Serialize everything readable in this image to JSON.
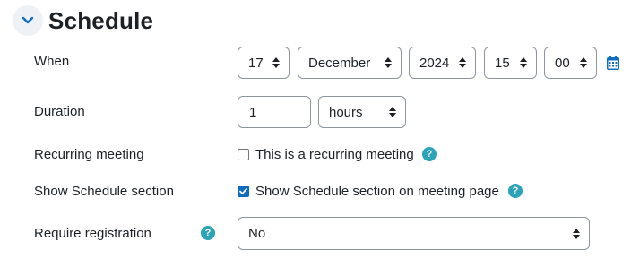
{
  "section": {
    "title": "Schedule",
    "toggle_icon": "chevron-down-icon"
  },
  "fields": {
    "when": {
      "label": "When",
      "day": "17",
      "month": "December",
      "year": "2024",
      "hour": "15",
      "minute": "00",
      "calendar_icon": "calendar-icon"
    },
    "duration": {
      "label": "Duration",
      "value": "1",
      "unit": "hours"
    },
    "recurring": {
      "label": "Recurring meeting",
      "checkbox_label": "This is a recurring meeting",
      "checked": false
    },
    "show_schedule": {
      "label": "Show Schedule section",
      "checkbox_label": "Show Schedule section on meeting page",
      "checked": true
    },
    "registration": {
      "label": "Require registration",
      "value": "No"
    }
  },
  "help_icon_text": "?",
  "colors": {
    "accent": "#0f6cbf",
    "help": "#2ba3b8",
    "toggle_bg": "#eef1f6",
    "text": "#1d2125",
    "border": "#8f959e"
  }
}
